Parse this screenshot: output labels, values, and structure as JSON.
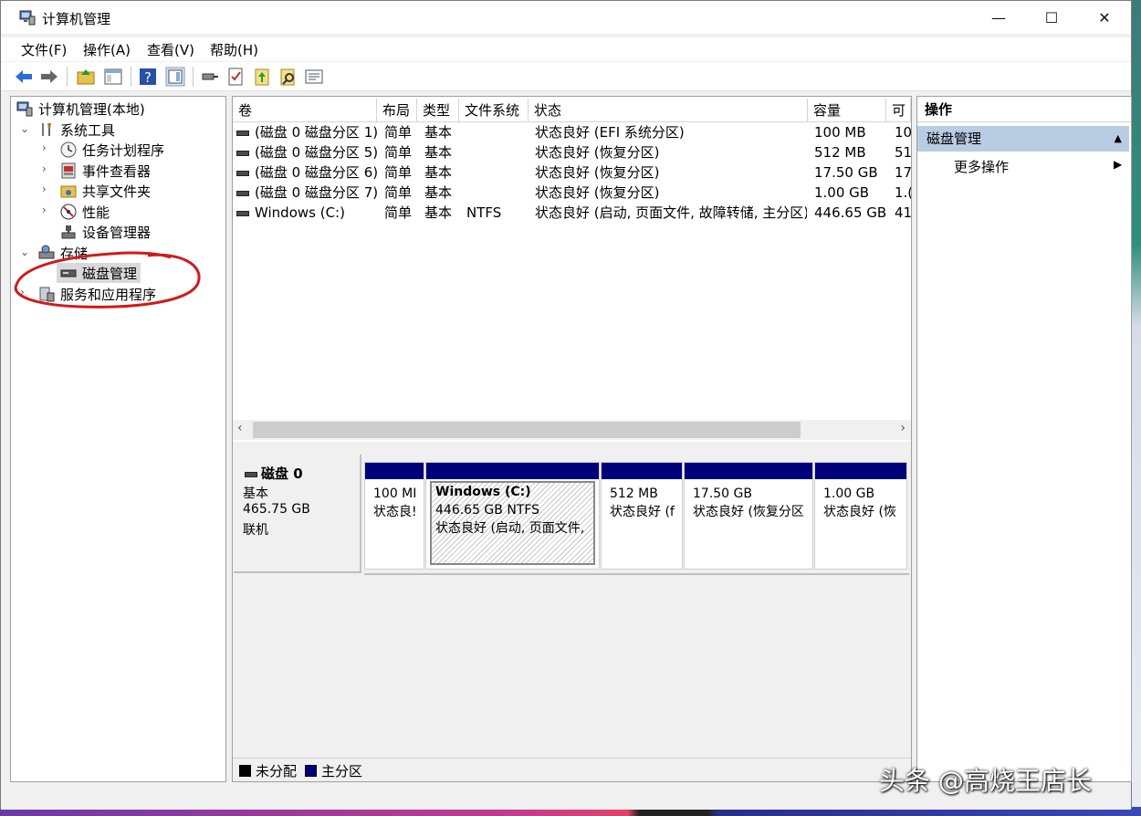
{
  "window": {
    "title": "计算机管理",
    "minimize": "—",
    "maximize": "☐",
    "close": "✕"
  },
  "menu": [
    "文件(F)",
    "操作(A)",
    "查看(V)",
    "帮助(H)"
  ],
  "tree": {
    "root": "计算机管理(本地)",
    "system_tools": "系统工具",
    "task_scheduler": "任务计划程序",
    "event_viewer": "事件查看器",
    "shared_folders": "共享文件夹",
    "performance": "性能",
    "device_manager": "设备管理器",
    "storage": "存储",
    "disk_management": "磁盘管理",
    "services_apps": "服务和应用程序"
  },
  "volume_list": {
    "columns": [
      "卷",
      "布局",
      "类型",
      "文件系统",
      "状态",
      "容量",
      "可"
    ],
    "rows": [
      {
        "volume": "(磁盘 0 磁盘分区 1)",
        "layout": "简单",
        "type": "基本",
        "fs": "",
        "status": "状态良好 (EFI 系统分区)",
        "capacity": "100 MB",
        "free": "10"
      },
      {
        "volume": "(磁盘 0 磁盘分区 5)",
        "layout": "简单",
        "type": "基本",
        "fs": "",
        "status": "状态良好 (恢复分区)",
        "capacity": "512 MB",
        "free": "51"
      },
      {
        "volume": "(磁盘 0 磁盘分区 6)",
        "layout": "简单",
        "type": "基本",
        "fs": "",
        "status": "状态良好 (恢复分区)",
        "capacity": "17.50 GB",
        "free": "17"
      },
      {
        "volume": "(磁盘 0 磁盘分区 7)",
        "layout": "简单",
        "type": "基本",
        "fs": "",
        "status": "状态良好 (恢复分区)",
        "capacity": "1.00 GB",
        "free": "1.("
      },
      {
        "volume": "Windows (C:)",
        "layout": "简单",
        "type": "基本",
        "fs": "NTFS",
        "status": "状态良好 (启动, 页面文件, 故障转储, 主分区)",
        "capacity": "446.65 GB",
        "free": "41"
      }
    ]
  },
  "disk": {
    "name": "磁盘 0",
    "kind": "基本",
    "size": "465.75 GB",
    "state": "联机",
    "partitions": [
      {
        "title": "",
        "line1": "100 MI",
        "line2": "状态良!"
      },
      {
        "title": "Windows  (C:)",
        "line1": "446.65 GB NTFS",
        "line2": "状态良好 (启动, 页面文件,"
      },
      {
        "title": "",
        "line1": "512 MB",
        "line2": "状态良好 (f"
      },
      {
        "title": "",
        "line1": "17.50 GB",
        "line2": "状态良好 (恢复分区"
      },
      {
        "title": "",
        "line1": "1.00 GB",
        "line2": "状态良好 (恢"
      }
    ]
  },
  "legend": {
    "unallocated": "未分配",
    "primary": "主分区"
  },
  "actions": {
    "header": "操作",
    "selected": "磁盘管理",
    "more": "更多操作"
  },
  "colors": {
    "primary_partition": "#00007a",
    "unallocated": "#000000",
    "selection": "#b8cce4",
    "annotation": "#d01a1a"
  },
  "watermark": "头条 @高烧王店长"
}
